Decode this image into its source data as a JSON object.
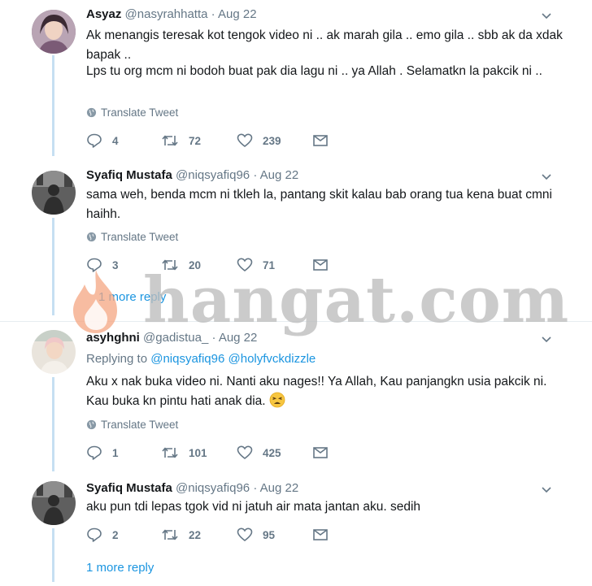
{
  "tweets": [
    {
      "name": "Asyaz",
      "handle": "@nasyrahhatta",
      "date": "Aug 22",
      "text1": "Ak menangis teresak kot tengok video ni .. ak marah gila .. emo gila .. sbb ak da xdak bapak ..",
      "text2": "Lps tu org mcm ni bodoh buat pak dia lagu ni .. ya Allah . Selamatkn la pakcik ni ..",
      "translate": "Translate Tweet",
      "replies": "4",
      "retweets": "72",
      "likes": "239"
    },
    {
      "name": "Syafiq Mustafa",
      "handle": "@niqsyafiq96",
      "date": "Aug 22",
      "text": "sama weh, benda mcm ni tkleh la, pantang skit kalau bab orang tua kena buat cmni haihh.",
      "translate": "Translate Tweet",
      "replies": "3",
      "retweets": "20",
      "likes": "71",
      "more_replies": "1 more reply"
    },
    {
      "name": "asyhghni",
      "handle": "@gadistua_",
      "date": "Aug 22",
      "replying_label": "Replying to",
      "replying_to_1": "@niqsyafiq96",
      "replying_to_2": "@holyfvckdizzle",
      "text": "Aku x nak buka video ni. Nanti aku nages!! Ya Allah, Kau panjangkn usia pakcik ni. Kau buka kn pintu hati anak dia.",
      "translate": "Translate Tweet",
      "replies": "1",
      "retweets": "101",
      "likes": "425"
    },
    {
      "name": "Syafiq Mustafa",
      "handle": "@niqsyafiq96",
      "date": "Aug 22",
      "text": "aku pun tdi lepas tgok vid ni jatuh air mata jantan aku. sedih",
      "replies": "2",
      "retweets": "22",
      "likes": "95",
      "more_replies": "1 more reply"
    }
  ],
  "separator": "·",
  "watermark": "hangat.com",
  "colors": {
    "link": "#1b95e0",
    "muted": "#657786",
    "thread_line": "#c6dff2",
    "watermark": "#bdbdbd",
    "flame": "#f4a582"
  },
  "icons": [
    "reply-icon",
    "retweet-icon",
    "like-icon",
    "dm-icon",
    "globe-icon",
    "chevron-down-icon",
    "weary-face-emoji"
  ]
}
